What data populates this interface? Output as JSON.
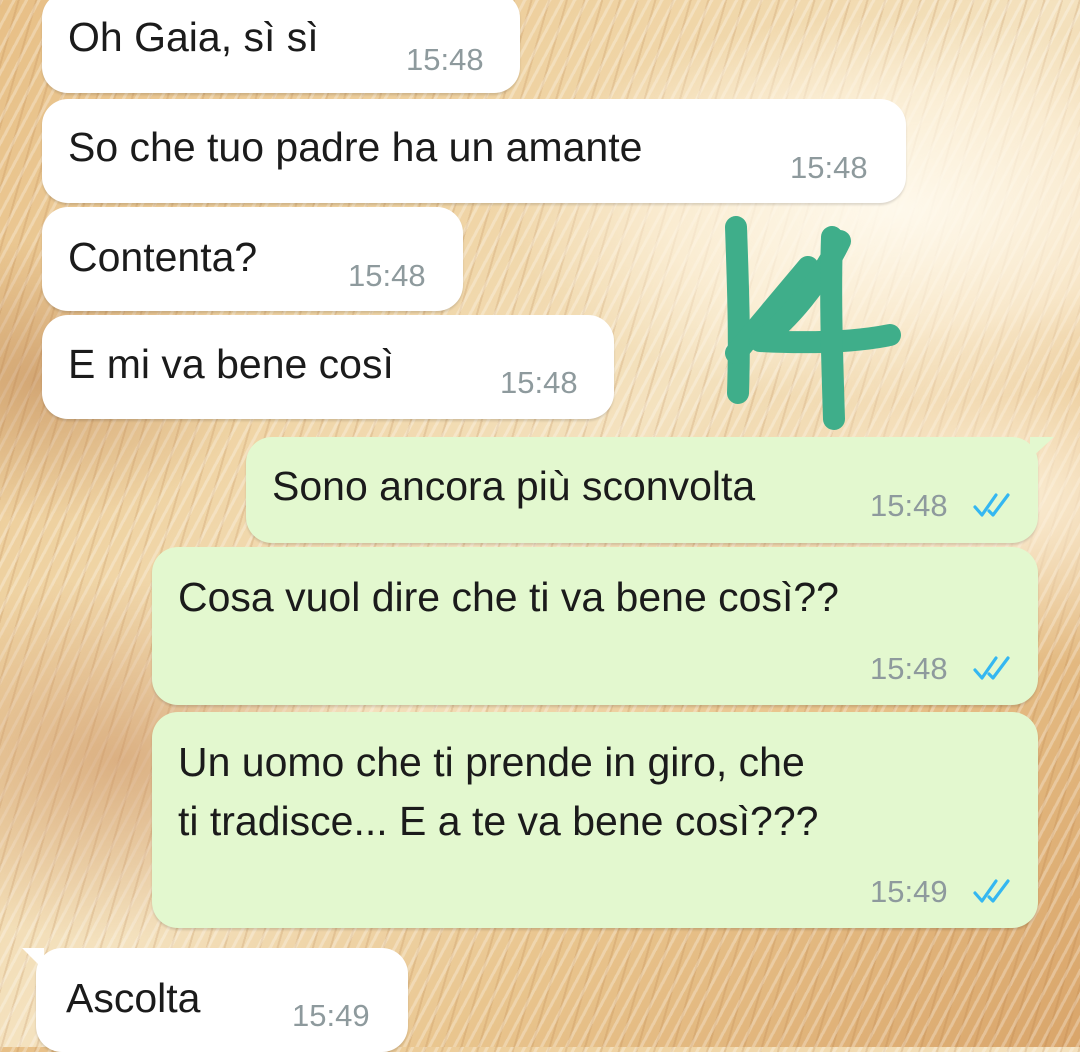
{
  "messages": [
    {
      "dir": "in",
      "lines": [
        "Oh Gaia, sì sì"
      ],
      "time": "15:48"
    },
    {
      "dir": "in",
      "lines": [
        "So che tuo padre ha un amante"
      ],
      "time": "15:48"
    },
    {
      "dir": "in",
      "lines": [
        "Contenta?"
      ],
      "time": "15:48"
    },
    {
      "dir": "in",
      "lines": [
        "E mi va bene così"
      ],
      "time": "15:48"
    },
    {
      "dir": "out",
      "lines": [
        "Sono ancora più sconvolta"
      ],
      "time": "15:48",
      "status": "read"
    },
    {
      "dir": "out",
      "lines": [
        "Cosa vuol dire che ti va bene così??"
      ],
      "time": "15:48",
      "status": "read"
    },
    {
      "dir": "out",
      "lines": [
        "Un uomo che ti prende in giro, che",
        "ti tradisce... E a te va bene così???"
      ],
      "time": "15:49",
      "status": "read"
    },
    {
      "dir": "in",
      "lines": [
        "Ascolta"
      ],
      "time": "15:49"
    }
  ],
  "overlay": {
    "handwritten_number": "14",
    "color": "#3fae8a"
  },
  "colors": {
    "incoming_bubble": "#ffffff",
    "outgoing_bubble": "#e3f8cf",
    "timestamp": "#8e9a9d",
    "read_ticks": "#34b7f1"
  },
  "icons": {
    "read_status": "double-check-icon"
  }
}
